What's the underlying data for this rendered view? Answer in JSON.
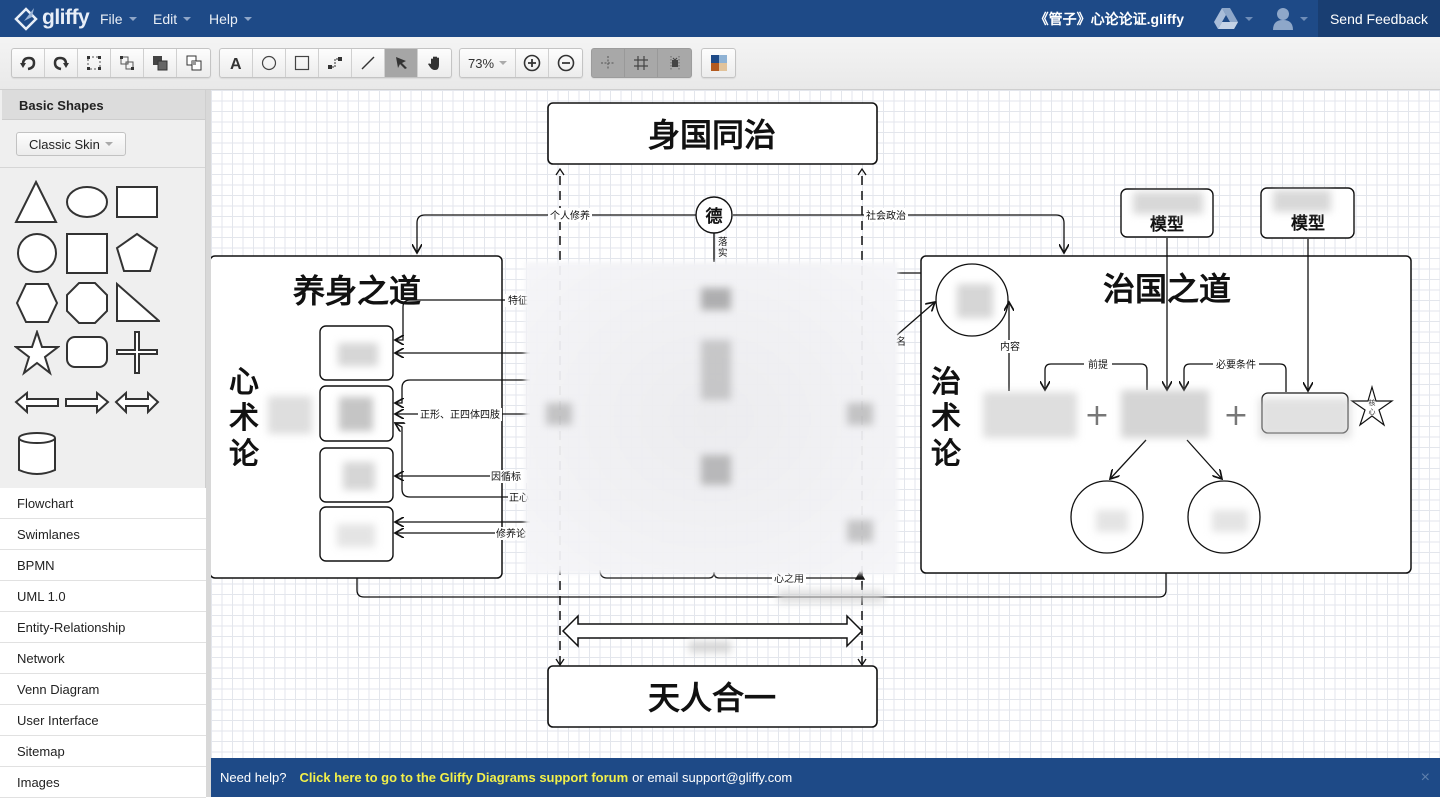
{
  "app": {
    "logo_text": "gliffy",
    "menus": [
      "File",
      "Edit",
      "Help"
    ],
    "document_title": "《管子》心论论证.gliffy",
    "send_feedback": "Send Feedback",
    "icons": {
      "drive": "google-drive-icon",
      "user": "user-icon"
    }
  },
  "toolbar": {
    "history": [
      {
        "name": "undo-button",
        "icon": "undo-icon"
      },
      {
        "name": "redo-button",
        "icon": "redo-icon"
      },
      {
        "name": "group-button",
        "icon": "group-icon"
      },
      {
        "name": "ungroup-button",
        "icon": "ungroup-icon"
      },
      {
        "name": "bring-to-front-button",
        "icon": "bring-front-icon"
      },
      {
        "name": "send-to-back-button",
        "icon": "send-back-icon"
      }
    ],
    "tools": [
      {
        "name": "text-tool",
        "icon": "text-icon",
        "active": false
      },
      {
        "name": "ellipse-tool",
        "icon": "ellipse-icon",
        "active": false
      },
      {
        "name": "rectangle-tool",
        "icon": "rectangle-icon",
        "active": false
      },
      {
        "name": "connector-tool",
        "icon": "connector-icon",
        "active": false
      },
      {
        "name": "line-tool",
        "icon": "line-icon",
        "active": false
      },
      {
        "name": "pointer-tool",
        "icon": "pointer-icon",
        "active": true
      },
      {
        "name": "pan-tool",
        "icon": "hand-icon",
        "active": false
      }
    ],
    "zoom_level": "73%",
    "zoom_in": "zoom-in-icon",
    "zoom_out": "zoom-out-icon",
    "grid_tools": [
      "snap-to-guides-icon",
      "grid-icon",
      "snap-to-grid-icon"
    ],
    "theme": "theme-palette-icon",
    "theme_colors": [
      "#1e4a87",
      "#8fb2d4",
      "#b35a1f",
      "#e2c39a"
    ]
  },
  "sidebar": {
    "panel_title": "Basic Shapes",
    "skin_selector": "Classic Skin",
    "shapes": [
      "triangle",
      "ellipse",
      "rectangle",
      "circle",
      "square",
      "pentagon",
      "hexagon",
      "octagon",
      "right-triangle",
      "star",
      "rounded-rectangle",
      "cross",
      "left-arrow",
      "right-arrow",
      "double-arrow",
      "cylinder"
    ],
    "libraries": [
      "Flowchart",
      "Swimlanes",
      "BPMN",
      "UML 1.0",
      "Entity-Relationship",
      "Network",
      "Venn Diagram",
      "User Interface",
      "Sitemap",
      "Images"
    ]
  },
  "diagram": {
    "top_box": "身国同治",
    "bottom_box": "天人合一",
    "de_circle": "德",
    "de_down_label": "落实",
    "left_label": "个人修养",
    "right_label": "社会政治",
    "left_panel": {
      "title": "养身之道",
      "side_title": "心术论",
      "labels": [
        "特征",
        "正形、正四体四肢",
        "因循标",
        "正心",
        "修养论"
      ]
    },
    "right_panel": {
      "title": "治国之道",
      "side_title": "治术论",
      "labels": [
        "内容",
        "前提",
        "必要条件"
      ],
      "star_label": "核心",
      "plus": "+",
      "models": [
        "模型",
        "模型"
      ],
      "left_edge_label": "名"
    },
    "center_bottom_label": "心之用"
  },
  "helpbar": {
    "prefix": "Need help?",
    "link": "Click here to go to the Gliffy Diagrams support forum",
    "suffix": "or email support@gliffy.com",
    "close": "×"
  }
}
